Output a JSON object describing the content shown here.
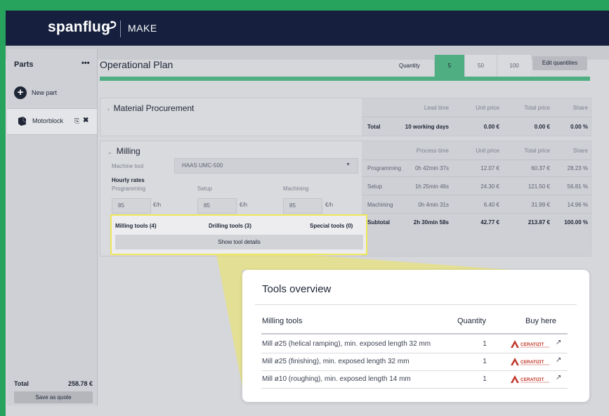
{
  "brand": {
    "name": "spanflug",
    "product": "MAKE"
  },
  "sidebar": {
    "title": "Parts",
    "menu": "•••",
    "new_part": "New part",
    "items": [
      {
        "label": "Motorblock"
      }
    ],
    "total_label": "Total",
    "total_value": "258.78 €",
    "save_quote": "Save as quote"
  },
  "plan": {
    "title": "Operational Plan",
    "quantity_label": "Quantity",
    "quantities": [
      "5",
      "50",
      "100"
    ],
    "selected_quantity": "5",
    "edit_quantities": "Edit quantities"
  },
  "procurement": {
    "title": "Material Procurement",
    "headers": [
      "Lead time",
      "Unit price",
      "Total price",
      "Share"
    ],
    "total": {
      "label": "Total",
      "lead_time": "10 working days",
      "unit_price": "0.00 €",
      "total_price": "0.00 €",
      "share": "0.00 %"
    }
  },
  "milling": {
    "title": "Milling",
    "machine_tool_label": "Machine tool",
    "machine_tool_value": "HAAS UMC-500",
    "hourly_rates_label": "Hourly rates",
    "rates": [
      {
        "label": "Programming",
        "value": "85",
        "unit": "€/h"
      },
      {
        "label": "Setup",
        "value": "85",
        "unit": "€/h"
      },
      {
        "label": "Machining",
        "value": "85",
        "unit": "€/h"
      }
    ],
    "tools": {
      "milling": "Milling tools (4)",
      "drilling": "Drilling tools (3)",
      "special": "Special tools (0)"
    },
    "show_details": "Show tool details",
    "headers": [
      "Process time",
      "Unit price",
      "Total price",
      "Share"
    ],
    "rows": [
      {
        "label": "Programming",
        "time": "0h 42min 37s",
        "unit": "12.07 €",
        "total": "60.37 €",
        "share": "28.23 %"
      },
      {
        "label": "Setup",
        "time": "1h 25min 46s",
        "unit": "24.30 €",
        "total": "121.50 €",
        "share": "56.81 %"
      },
      {
        "label": "Machining",
        "time": "0h 4min 31s",
        "unit": "6.40 €",
        "total": "31.99 €",
        "share": "14.96 %"
      },
      {
        "label": "Subtotal",
        "time": "2h 30min 58s",
        "unit": "42.77 €",
        "total": "213.87 €",
        "share": "100.00 %"
      }
    ]
  },
  "popup": {
    "title": "Tools overview",
    "col_name": "Milling tools",
    "col_qty": "Quantity",
    "col_buy": "Buy here",
    "vendor": "CERATIZIT",
    "rows": [
      {
        "name": "Mill ø25 (helical ramping), min. exposed length 32 mm",
        "qty": "1"
      },
      {
        "name": "Mill ø25 (finishing), min. exposed length 32 mm",
        "qty": "1"
      },
      {
        "name": "Mill ø10 (roughing), min. exposed length 14 mm",
        "qty": "1"
      }
    ]
  },
  "colors": {
    "accent_green": "#4fae82",
    "navy": "#16203e",
    "highlight": "#efe65a"
  }
}
